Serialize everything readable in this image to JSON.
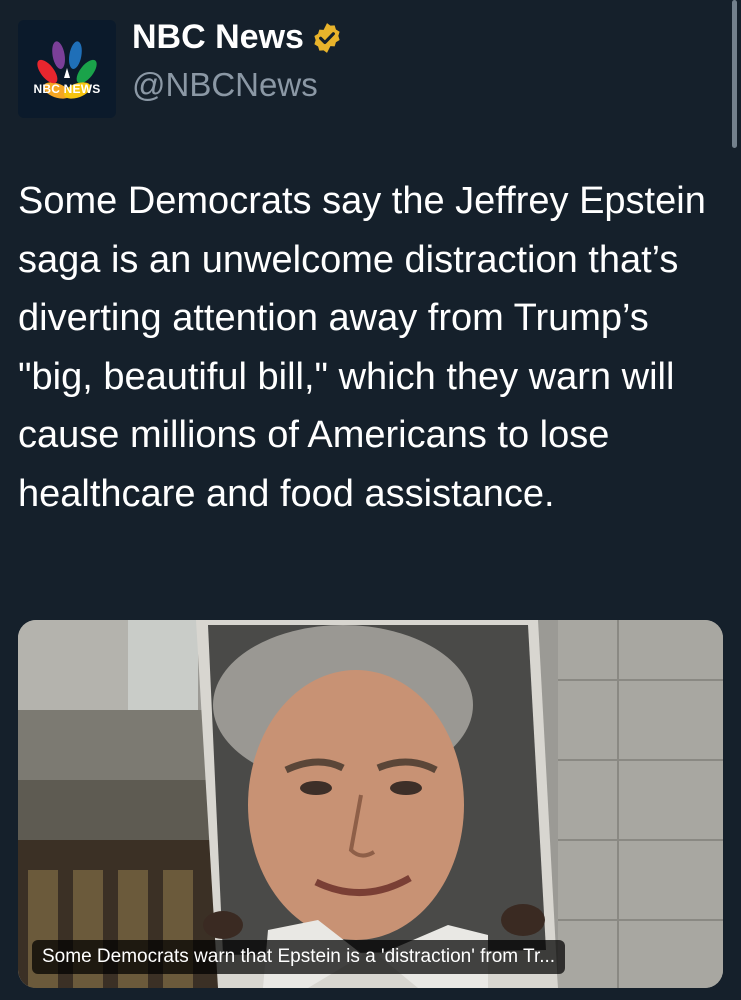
{
  "account": {
    "display_name": "NBC News",
    "handle": "@NBCNews",
    "avatar_text": "NBC NEWS",
    "verified_icon": "verified-gold-badge-icon"
  },
  "tweet": {
    "text": "Some Democrats say the Jeffrey Epstein saga is an unwelcome distraction that’s diverting attention away from Trump’s \"big, beautiful bill,\" which they warn will cause millions of Americans to lose healthcare and food assistance."
  },
  "media": {
    "caption": "Some Democrats warn that Epstein is a 'distraction' from Tr..."
  },
  "colors": {
    "background": "#15202b",
    "text": "#ffffff",
    "secondary_text": "#8b98a5",
    "verified": "#e8b32b"
  }
}
